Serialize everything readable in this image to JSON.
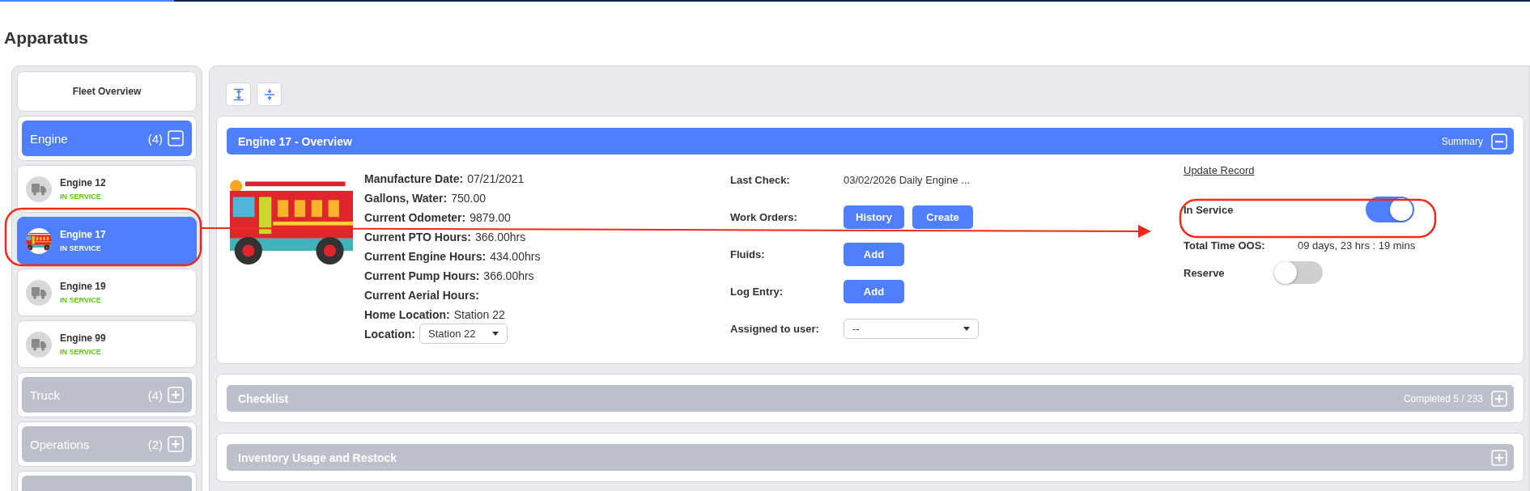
{
  "page_title": "Apparatus",
  "sidebar": {
    "fleet_overview": "Fleet Overview",
    "groups": [
      {
        "name": "Engine",
        "count": "(4)",
        "expanded": true,
        "items": [
          {
            "name": "Engine 12",
            "status": "IN SERVICE",
            "selected": false,
            "has_photo": false
          },
          {
            "name": "Engine 17",
            "status": "IN SERVICE",
            "selected": true,
            "has_photo": true
          },
          {
            "name": "Engine 19",
            "status": "IN SERVICE",
            "selected": false,
            "has_photo": false
          },
          {
            "name": "Engine 99",
            "status": "IN SERVICE",
            "selected": false,
            "has_photo": false
          }
        ]
      },
      {
        "name": "Truck",
        "count": "(4)",
        "expanded": false
      },
      {
        "name": "Operations",
        "count": "(2)",
        "expanded": false
      }
    ]
  },
  "overview": {
    "title": "Engine 17 - Overview",
    "summary_label": "Summary",
    "expanded": true,
    "details": [
      {
        "label": "Manufacture Date:",
        "value": "07/21/2021"
      },
      {
        "label": "Gallons, Water:",
        "value": "750.00"
      },
      {
        "label": "Current Odometer:",
        "value": "9879.00"
      },
      {
        "label": "Current PTO Hours:",
        "value": "366.00hrs"
      },
      {
        "label": "Current Engine Hours:",
        "value": "434.00hrs"
      },
      {
        "label": "Current Pump Hours:",
        "value": "366.00hrs"
      },
      {
        "label": "Current Aerial Hours:"
      },
      {
        "label": "Home Location:",
        "value": "Station 22"
      },
      {
        "label": "Location:",
        "select": "Station 22"
      }
    ],
    "actions": [
      {
        "label": "Last Check:",
        "kind": "text",
        "value": "03/02/2026 Daily Engine ..."
      },
      {
        "label": "Work Orders:",
        "kind": "buttons",
        "buttons": [
          "History",
          "Create"
        ]
      },
      {
        "label": "Fluids:",
        "kind": "buttons",
        "buttons": [
          "Add"
        ]
      },
      {
        "label": "Log Entry:",
        "kind": "buttons",
        "buttons": [
          "Add"
        ]
      },
      {
        "label": "Assigned to user:",
        "kind": "select",
        "value": "--"
      }
    ],
    "status": {
      "update_link": "Update Record",
      "in_service": {
        "label": "In Service",
        "on": true
      },
      "total_oos": {
        "label": "Total Time OOS:",
        "value": "09 days, 23 hrs : 19 mins"
      },
      "reserve": {
        "label": "Reserve",
        "on": false
      }
    }
  },
  "sections": [
    {
      "title": "Checklist",
      "summary": "Completed 5 / 233",
      "expanded": false
    },
    {
      "title": "Inventory Usage and Restock",
      "expanded": false
    }
  ]
}
